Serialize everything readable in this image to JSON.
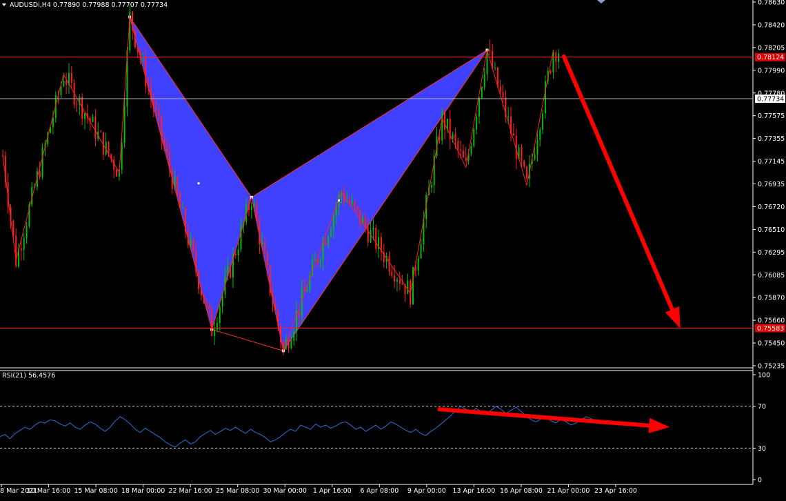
{
  "colors": {
    "background": "#000000",
    "axis_line": "#ffffff",
    "axis_text": "#ffffff",
    "candle_up": "#00c000",
    "candle_down": "#ff2020",
    "zigzag": "#ff2020",
    "pattern_fill": "#4040ff",
    "pattern_edge": "#ff3030",
    "hline_red": "#ff2020",
    "hline_white": "#b0b0b0",
    "rsi_line": "#2a72d8",
    "rsi_level": "#cfcfcf",
    "arrow": "#ff0000",
    "red_label_bg": "#e00000"
  },
  "chart_data": [
    {
      "type": "candlestick",
      "header": {
        "dropdown_icon": "triangle-down-icon",
        "text": "AUDUSDi,H4  0.77890 0.77988 0.77707 0.77734"
      },
      "price_ticks": [
        "0.78630",
        "0.78420",
        "0.78205",
        "0.77990",
        "0.77780",
        "0.77575",
        "0.77355",
        "0.77145",
        "0.76935",
        "0.76720",
        "0.76510",
        "0.76295",
        "0.76085",
        "0.75870",
        "0.75660",
        "0.75450",
        "0.75235"
      ],
      "ylim": [
        0.7523,
        0.7864
      ],
      "x_ticks": [
        "8 Mar 2021",
        "10 Mar 16:00",
        "15 Mar 08:00",
        "18 Mar 00:00",
        "22 Mar 16:00",
        "25 Mar 08:00",
        "30 Mar 00:00",
        "1 Apr 16:00",
        "6 Apr 08:00",
        "9 Apr 00:00",
        "13 Apr 16:00",
        "16 Apr 08:00",
        "21 Apr 00:00",
        "23 Apr 16:00"
      ],
      "bars": 280,
      "pattern": {
        "shape": "harmonic-butterfly",
        "points": [
          {
            "x": 48,
            "y": 0.785
          },
          {
            "x": 79,
            "y": 0.7557
          },
          {
            "x": 94,
            "y": 0.7681
          },
          {
            "x": 106,
            "y": 0.7537
          },
          {
            "x": 183,
            "y": 0.7819
          }
        ]
      },
      "zigzag": [
        {
          "x": 0,
          "y": 0.772
        },
        {
          "x": 5,
          "y": 0.7622
        },
        {
          "x": 23,
          "y": 0.7796
        },
        {
          "x": 44,
          "y": 0.7704
        },
        {
          "x": 48,
          "y": 0.785
        },
        {
          "x": 79,
          "y": 0.7557
        },
        {
          "x": 94,
          "y": 0.7681
        },
        {
          "x": 106,
          "y": 0.7537
        },
        {
          "x": 128,
          "y": 0.7686
        },
        {
          "x": 154,
          "y": 0.7591
        },
        {
          "x": 166,
          "y": 0.7755
        },
        {
          "x": 175,
          "y": 0.7709
        },
        {
          "x": 183,
          "y": 0.7819
        },
        {
          "x": 198,
          "y": 0.7692
        },
        {
          "x": 208,
          "y": 0.7819
        }
      ],
      "marker_points": [
        {
          "x": 74,
          "y": 0.7694
        },
        {
          "x": 127,
          "y": 0.7678
        }
      ],
      "horizontal_lines": [
        {
          "y": 0.78124,
          "style": "red",
          "label": "0.78124"
        },
        {
          "y": 0.77734,
          "style": "white",
          "label": "0.77734"
        },
        {
          "y": 0.75583,
          "style": "red",
          "label": "0.75583"
        }
      ],
      "annotations": [
        {
          "kind": "arrow",
          "panel": "price",
          "from": {
            "x": 212,
            "y": 0.7813
          },
          "to": {
            "x": 256,
            "y": 0.7558
          }
        }
      ],
      "ohlc_series": [
        [
          0.77,
          0.772,
          0.769,
          0.7715
        ],
        [
          0.7715,
          0.7718,
          0.764,
          0.765
        ],
        [
          0.765,
          0.766,
          0.762,
          0.763
        ],
        [
          0.763,
          0.768,
          0.7625,
          0.767
        ],
        [
          0.767,
          0.772,
          0.766,
          0.771
        ],
        [
          0.771,
          0.779,
          0.77,
          0.778
        ],
        [
          0.778,
          0.78,
          0.774,
          0.775
        ],
        [
          0.775,
          0.776,
          0.772,
          0.773
        ],
        [
          0.773,
          0.7745,
          0.77,
          0.771
        ],
        [
          0.771,
          0.785,
          0.7705,
          0.784
        ],
        [
          0.784,
          0.7845,
          0.776,
          0.777
        ],
        [
          0.777,
          0.778,
          0.77,
          0.771
        ],
        [
          0.771,
          0.772,
          0.762,
          0.763
        ],
        [
          0.763,
          0.764,
          0.756,
          0.757
        ],
        [
          0.757,
          0.762,
          0.7555,
          0.761
        ],
        [
          0.761,
          0.768,
          0.76,
          0.767
        ],
        [
          0.767,
          0.769,
          0.758,
          0.759
        ],
        [
          0.759,
          0.76,
          0.7537,
          0.755
        ],
        [
          0.755,
          0.763,
          0.7545,
          0.762
        ],
        [
          0.762,
          0.768,
          0.761,
          0.767
        ],
        [
          0.767,
          0.7686,
          0.76,
          0.761
        ],
        [
          0.761,
          0.764,
          0.759,
          0.763
        ],
        [
          0.763,
          0.766,
          0.76,
          0.761
        ],
        [
          0.761,
          0.77,
          0.76,
          0.769
        ],
        [
          0.769,
          0.776,
          0.768,
          0.775
        ],
        [
          0.775,
          0.776,
          0.771,
          0.772
        ],
        [
          0.772,
          0.779,
          0.771,
          0.778
        ],
        [
          0.778,
          0.7819,
          0.772,
          0.773
        ],
        [
          0.773,
          0.776,
          0.7692,
          0.77
        ],
        [
          0.77,
          0.777,
          0.769,
          0.776
        ],
        [
          0.776,
          0.7819,
          0.775,
          0.779
        ],
        [
          0.779,
          0.78,
          0.776,
          0.7773
        ]
      ]
    },
    {
      "type": "line",
      "title": "RSI(21) 56.4576",
      "y_ticks": [
        "100",
        "70",
        "30",
        "0"
      ],
      "ylim": [
        0,
        100
      ],
      "levels": [
        70,
        30
      ],
      "values": [
        41,
        43,
        39,
        44,
        47,
        50,
        48,
        52,
        55,
        54,
        57,
        56,
        53,
        51,
        54,
        50,
        48,
        52,
        55,
        53,
        49,
        46,
        50,
        56,
        60,
        57,
        53,
        48,
        45,
        49,
        46,
        43,
        40,
        36,
        33,
        31,
        35,
        38,
        34,
        36,
        41,
        44,
        47,
        43,
        46,
        49,
        47,
        50,
        47,
        44,
        48,
        45,
        43,
        40,
        36,
        38,
        41,
        45,
        48,
        46,
        52,
        50,
        48,
        53,
        50,
        52,
        49,
        51,
        54,
        55,
        52,
        48,
        50,
        46,
        49,
        52,
        48,
        51,
        55,
        53,
        50,
        47,
        45,
        48,
        44,
        42,
        46,
        49,
        53,
        57,
        61,
        66,
        70,
        67,
        64,
        68,
        65,
        62,
        66,
        70,
        67,
        63,
        66,
        69,
        65,
        61,
        57,
        55,
        58,
        60,
        56,
        54,
        58,
        55,
        52,
        54,
        57,
        60,
        58,
        56,
        56
      ],
      "annotations": [
        {
          "kind": "arrow",
          "panel": "rsi",
          "from": {
            "x": 165,
            "y": 67
          },
          "to": {
            "x": 252,
            "y": 50
          }
        }
      ]
    }
  ]
}
